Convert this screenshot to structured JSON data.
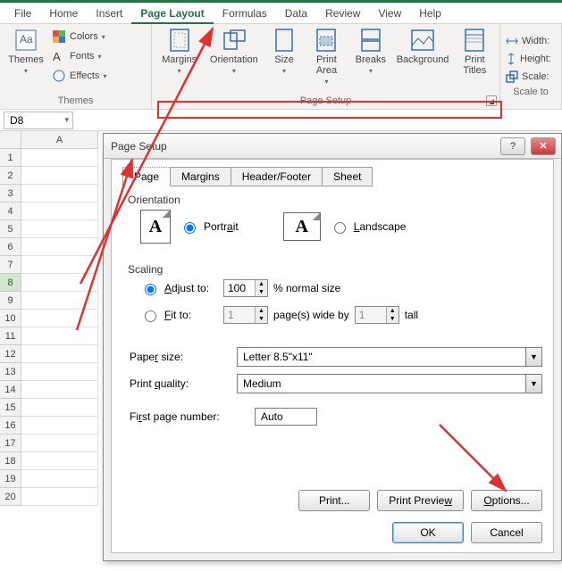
{
  "menu": {
    "file": "File",
    "home": "Home",
    "insert": "Insert",
    "page_layout": "Page Layout",
    "formulas": "Formulas",
    "data": "Data",
    "review": "Review",
    "view": "View",
    "help": "Help"
  },
  "ribbon": {
    "themes": {
      "label": "Themes",
      "btn": "Themes",
      "colors": "Colors",
      "fonts": "Fonts",
      "effects": "Effects"
    },
    "page_setup": {
      "label": "Page Setup",
      "margins": "Margins",
      "orientation": "Orientation",
      "size": "Size",
      "print_area": "Print\nArea",
      "breaks": "Breaks",
      "background": "Background",
      "print_titles": "Print\nTitles"
    },
    "scale": {
      "label": "Scale to",
      "width": "Width:",
      "height": "Height:",
      "scale": "Scale:"
    }
  },
  "namebox": "D8",
  "col_header": "A",
  "rows": [
    "1",
    "2",
    "3",
    "4",
    "5",
    "6",
    "7",
    "8",
    "9",
    "10",
    "11",
    "12",
    "13",
    "14",
    "15",
    "16",
    "17",
    "18",
    "19",
    "20"
  ],
  "dialog": {
    "title": "Page Setup",
    "tabs": {
      "page": "Page",
      "margins": "Margins",
      "hf": "Header/Footer",
      "sheet": "Sheet"
    },
    "orientation": {
      "label": "Orientation",
      "portrait": "Portrait",
      "landscape": "Landscape"
    },
    "scaling": {
      "label": "Scaling",
      "adjust": "Adjust to:",
      "adjust_val": "100",
      "adjust_suffix": "% normal size",
      "fit": "Fit to:",
      "fit_w": "1",
      "fit_mid": "page(s) wide by",
      "fit_h": "1",
      "fit_suffix": "tall"
    },
    "paper": {
      "label": "Paper size:",
      "value": "Letter 8.5\"x11\""
    },
    "quality": {
      "label": "Print quality:",
      "value": "Medium"
    },
    "firstpg": {
      "label": "First page number:",
      "value": "Auto"
    },
    "buttons": {
      "print": "Print...",
      "preview": "Print Preview",
      "options": "Options...",
      "ok": "OK",
      "cancel": "Cancel"
    }
  }
}
